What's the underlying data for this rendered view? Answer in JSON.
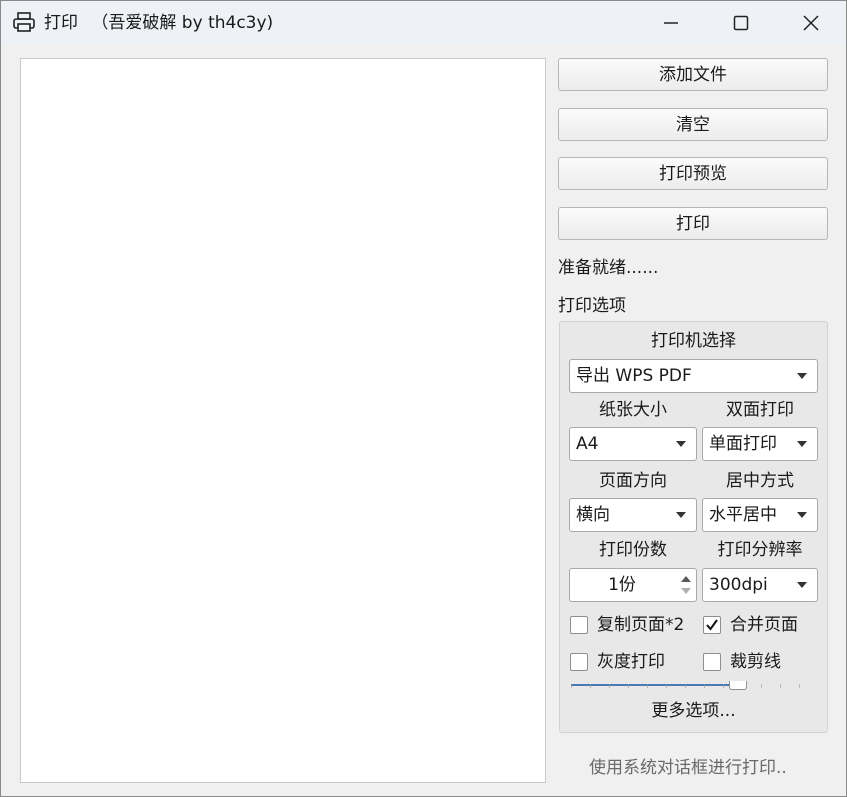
{
  "window": {
    "title": "打印",
    "subtitle": "（吾爱破解 by th4c3y)",
    "icon": "printer-icon"
  },
  "titlebar_buttons": {
    "minimize_icon": "minimize-icon",
    "maximize_icon": "maximize-icon",
    "close_icon": "close-icon"
  },
  "actions": {
    "add_file": "添加文件",
    "clear": "清空",
    "print_preview": "打印预览",
    "print": "打印"
  },
  "status_text": "准备就绪......",
  "options": {
    "section_title": "打印选项",
    "printer_label": "打印机选择",
    "printer_value": "导出 WPS PDF",
    "paper_size_label": "纸张大小",
    "paper_size_value": "A4",
    "duplex_label": "双面打印",
    "duplex_value": "单面打印",
    "orientation_label": "页面方向",
    "orientation_value": "横向",
    "centering_label": "居中方式",
    "centering_value": "水平居中",
    "copies_label": "打印份数",
    "copies_value": "1份",
    "resolution_label": "打印分辨率",
    "resolution_value": "300dpi",
    "checkboxes": [
      {
        "label": "复制页面*2",
        "checked": false
      },
      {
        "label": "合并页面",
        "checked": true
      },
      {
        "label": "灰度打印",
        "checked": false
      },
      {
        "label": "裁剪线",
        "checked": false
      }
    ],
    "slider_level_fraction": 0.68,
    "more_options": "更多选项..."
  },
  "system_dialog_link": "使用系统对话框进行打印.."
}
